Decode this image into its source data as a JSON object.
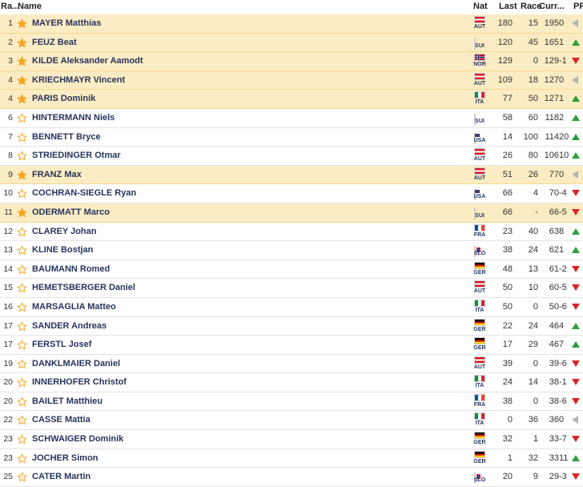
{
  "header": {
    "rank": "Ra...",
    "name": "Name",
    "nat": "Nat",
    "last": "Last",
    "race": "Race",
    "curr": "Curr...",
    "pf": "PF"
  },
  "colors": {
    "favorite_row": "#fcecc3",
    "star_filled": "#f5a623",
    "up": "#2e9e3c",
    "down": "#d92626",
    "same": "#b5b5b5",
    "name_text": "#27355e"
  },
  "rows": [
    {
      "rank": "1",
      "name": "MAYER Matthias",
      "nat": "AUT",
      "last": "180",
      "race": "15",
      "curr": "195",
      "pf": "0",
      "trend": "same",
      "fav": true
    },
    {
      "rank": "2",
      "name": "FEUZ Beat",
      "nat": "SUI",
      "last": "120",
      "race": "45",
      "curr": "165",
      "pf": "1",
      "trend": "up",
      "fav": true
    },
    {
      "rank": "3",
      "name": "KILDE Aleksander Aamodt",
      "nat": "NOR",
      "last": "129",
      "race": "0",
      "curr": "129",
      "pf": "-1",
      "trend": "down",
      "fav": true
    },
    {
      "rank": "4",
      "name": "KRIECHMAYR Vincent",
      "nat": "AUT",
      "last": "109",
      "race": "18",
      "curr": "127",
      "pf": "0",
      "trend": "same",
      "fav": true
    },
    {
      "rank": "4",
      "name": "PARIS Dominik",
      "nat": "ITA",
      "last": "77",
      "race": "50",
      "curr": "127",
      "pf": "1",
      "trend": "up",
      "fav": true
    },
    {
      "rank": "6",
      "name": "HINTERMANN Niels",
      "nat": "SUI",
      "last": "58",
      "race": "60",
      "curr": "118",
      "pf": "2",
      "trend": "up",
      "fav": false
    },
    {
      "rank": "7",
      "name": "BENNETT Bryce",
      "nat": "USA",
      "last": "14",
      "race": "100",
      "curr": "114",
      "pf": "20",
      "trend": "up",
      "fav": false
    },
    {
      "rank": "8",
      "name": "STRIEDINGER Otmar",
      "nat": "AUT",
      "last": "26",
      "race": "80",
      "curr": "106",
      "pf": "10",
      "trend": "up",
      "fav": false
    },
    {
      "rank": "9",
      "name": "FRANZ Max",
      "nat": "AUT",
      "last": "51",
      "race": "26",
      "curr": "77",
      "pf": "0",
      "trend": "same",
      "fav": true
    },
    {
      "rank": "10",
      "name": "COCHRAN-SIEGLE Ryan",
      "nat": "USA",
      "last": "66",
      "race": "4",
      "curr": "70",
      "pf": "-4",
      "trend": "down",
      "fav": false
    },
    {
      "rank": "11",
      "name": "ODERMATT Marco",
      "nat": "SUI",
      "last": "66",
      "race": "-",
      "curr": "66",
      "pf": "-5",
      "trend": "down",
      "fav": true
    },
    {
      "rank": "12",
      "name": "CLAREY Johan",
      "nat": "FRA",
      "last": "23",
      "race": "40",
      "curr": "63",
      "pf": "8",
      "trend": "up",
      "fav": false
    },
    {
      "rank": "13",
      "name": "KLINE Bostjan",
      "nat": "SLO",
      "last": "38",
      "race": "24",
      "curr": "62",
      "pf": "1",
      "trend": "up",
      "fav": false
    },
    {
      "rank": "14",
      "name": "BAUMANN Romed",
      "nat": "GER",
      "last": "48",
      "race": "13",
      "curr": "61",
      "pf": "-2",
      "trend": "down",
      "fav": false
    },
    {
      "rank": "15",
      "name": "HEMETSBERGER Daniel",
      "nat": "AUT",
      "last": "50",
      "race": "10",
      "curr": "60",
      "pf": "-5",
      "trend": "down",
      "fav": false
    },
    {
      "rank": "16",
      "name": "MARSAGLIA Matteo",
      "nat": "ITA",
      "last": "50",
      "race": "0",
      "curr": "50",
      "pf": "-6",
      "trend": "down",
      "fav": false
    },
    {
      "rank": "17",
      "name": "SANDER Andreas",
      "nat": "GER",
      "last": "22",
      "race": "24",
      "curr": "46",
      "pf": "4",
      "trend": "up",
      "fav": false
    },
    {
      "rank": "17",
      "name": "FERSTL Josef",
      "nat": "GER",
      "last": "17",
      "race": "29",
      "curr": "46",
      "pf": "7",
      "trend": "up",
      "fav": false
    },
    {
      "rank": "19",
      "name": "DANKLMAIER Daniel",
      "nat": "AUT",
      "last": "39",
      "race": "0",
      "curr": "39",
      "pf": "-6",
      "trend": "down",
      "fav": false
    },
    {
      "rank": "20",
      "name": "INNERHOFER Christof",
      "nat": "ITA",
      "last": "24",
      "race": "14",
      "curr": "38",
      "pf": "-1",
      "trend": "down",
      "fav": false
    },
    {
      "rank": "20",
      "name": "BAILET Matthieu",
      "nat": "FRA",
      "last": "38",
      "race": "0",
      "curr": "38",
      "pf": "-6",
      "trend": "down",
      "fav": false
    },
    {
      "rank": "22",
      "name": "CASSE Mattia",
      "nat": "ITA",
      "last": "0",
      "race": "36",
      "curr": "36",
      "pf": "0",
      "trend": "same",
      "fav": false
    },
    {
      "rank": "23",
      "name": "SCHWAIGER Dominik",
      "nat": "GER",
      "last": "32",
      "race": "1",
      "curr": "33",
      "pf": "-7",
      "trend": "down",
      "fav": false
    },
    {
      "rank": "23",
      "name": "JOCHER Simon",
      "nat": "GER",
      "last": "1",
      "race": "32",
      "curr": "33",
      "pf": "11",
      "trend": "up",
      "fav": false
    },
    {
      "rank": "25",
      "name": "CATER Martin",
      "nat": "SLO",
      "last": "20",
      "race": "9",
      "curr": "29",
      "pf": "-3",
      "trend": "down",
      "fav": false
    }
  ]
}
